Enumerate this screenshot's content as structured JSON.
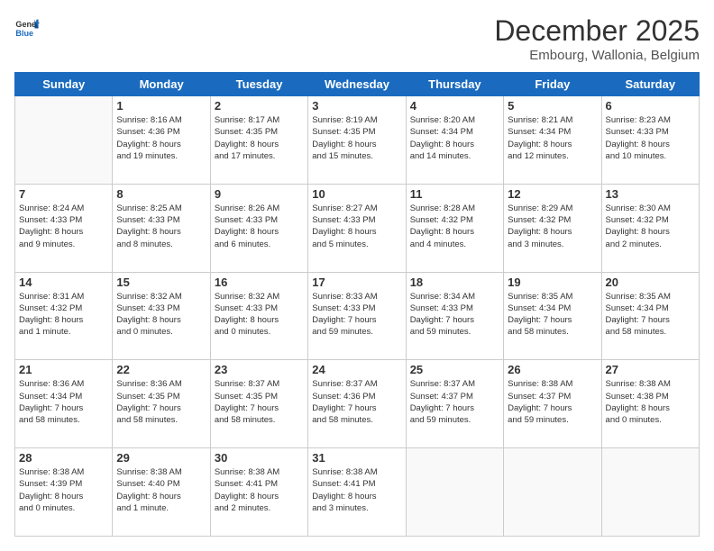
{
  "header": {
    "logo_general": "General",
    "logo_blue": "Blue",
    "month_year": "December 2025",
    "location": "Embourg, Wallonia, Belgium"
  },
  "weekdays": [
    "Sunday",
    "Monday",
    "Tuesday",
    "Wednesday",
    "Thursday",
    "Friday",
    "Saturday"
  ],
  "weeks": [
    [
      {
        "day": "",
        "info": ""
      },
      {
        "day": "1",
        "info": "Sunrise: 8:16 AM\nSunset: 4:36 PM\nDaylight: 8 hours\nand 19 minutes."
      },
      {
        "day": "2",
        "info": "Sunrise: 8:17 AM\nSunset: 4:35 PM\nDaylight: 8 hours\nand 17 minutes."
      },
      {
        "day": "3",
        "info": "Sunrise: 8:19 AM\nSunset: 4:35 PM\nDaylight: 8 hours\nand 15 minutes."
      },
      {
        "day": "4",
        "info": "Sunrise: 8:20 AM\nSunset: 4:34 PM\nDaylight: 8 hours\nand 14 minutes."
      },
      {
        "day": "5",
        "info": "Sunrise: 8:21 AM\nSunset: 4:34 PM\nDaylight: 8 hours\nand 12 minutes."
      },
      {
        "day": "6",
        "info": "Sunrise: 8:23 AM\nSunset: 4:33 PM\nDaylight: 8 hours\nand 10 minutes."
      }
    ],
    [
      {
        "day": "7",
        "info": "Sunrise: 8:24 AM\nSunset: 4:33 PM\nDaylight: 8 hours\nand 9 minutes."
      },
      {
        "day": "8",
        "info": "Sunrise: 8:25 AM\nSunset: 4:33 PM\nDaylight: 8 hours\nand 8 minutes."
      },
      {
        "day": "9",
        "info": "Sunrise: 8:26 AM\nSunset: 4:33 PM\nDaylight: 8 hours\nand 6 minutes."
      },
      {
        "day": "10",
        "info": "Sunrise: 8:27 AM\nSunset: 4:33 PM\nDaylight: 8 hours\nand 5 minutes."
      },
      {
        "day": "11",
        "info": "Sunrise: 8:28 AM\nSunset: 4:32 PM\nDaylight: 8 hours\nand 4 minutes."
      },
      {
        "day": "12",
        "info": "Sunrise: 8:29 AM\nSunset: 4:32 PM\nDaylight: 8 hours\nand 3 minutes."
      },
      {
        "day": "13",
        "info": "Sunrise: 8:30 AM\nSunset: 4:32 PM\nDaylight: 8 hours\nand 2 minutes."
      }
    ],
    [
      {
        "day": "14",
        "info": "Sunrise: 8:31 AM\nSunset: 4:32 PM\nDaylight: 8 hours\nand 1 minute."
      },
      {
        "day": "15",
        "info": "Sunrise: 8:32 AM\nSunset: 4:33 PM\nDaylight: 8 hours\nand 0 minutes."
      },
      {
        "day": "16",
        "info": "Sunrise: 8:32 AM\nSunset: 4:33 PM\nDaylight: 8 hours\nand 0 minutes."
      },
      {
        "day": "17",
        "info": "Sunrise: 8:33 AM\nSunset: 4:33 PM\nDaylight: 7 hours\nand 59 minutes."
      },
      {
        "day": "18",
        "info": "Sunrise: 8:34 AM\nSunset: 4:33 PM\nDaylight: 7 hours\nand 59 minutes."
      },
      {
        "day": "19",
        "info": "Sunrise: 8:35 AM\nSunset: 4:34 PM\nDaylight: 7 hours\nand 58 minutes."
      },
      {
        "day": "20",
        "info": "Sunrise: 8:35 AM\nSunset: 4:34 PM\nDaylight: 7 hours\nand 58 minutes."
      }
    ],
    [
      {
        "day": "21",
        "info": "Sunrise: 8:36 AM\nSunset: 4:34 PM\nDaylight: 7 hours\nand 58 minutes."
      },
      {
        "day": "22",
        "info": "Sunrise: 8:36 AM\nSunset: 4:35 PM\nDaylight: 7 hours\nand 58 minutes."
      },
      {
        "day": "23",
        "info": "Sunrise: 8:37 AM\nSunset: 4:35 PM\nDaylight: 7 hours\nand 58 minutes."
      },
      {
        "day": "24",
        "info": "Sunrise: 8:37 AM\nSunset: 4:36 PM\nDaylight: 7 hours\nand 58 minutes."
      },
      {
        "day": "25",
        "info": "Sunrise: 8:37 AM\nSunset: 4:37 PM\nDaylight: 7 hours\nand 59 minutes."
      },
      {
        "day": "26",
        "info": "Sunrise: 8:38 AM\nSunset: 4:37 PM\nDaylight: 7 hours\nand 59 minutes."
      },
      {
        "day": "27",
        "info": "Sunrise: 8:38 AM\nSunset: 4:38 PM\nDaylight: 8 hours\nand 0 minutes."
      }
    ],
    [
      {
        "day": "28",
        "info": "Sunrise: 8:38 AM\nSunset: 4:39 PM\nDaylight: 8 hours\nand 0 minutes."
      },
      {
        "day": "29",
        "info": "Sunrise: 8:38 AM\nSunset: 4:40 PM\nDaylight: 8 hours\nand 1 minute."
      },
      {
        "day": "30",
        "info": "Sunrise: 8:38 AM\nSunset: 4:41 PM\nDaylight: 8 hours\nand 2 minutes."
      },
      {
        "day": "31",
        "info": "Sunrise: 8:38 AM\nSunset: 4:41 PM\nDaylight: 8 hours\nand 3 minutes."
      },
      {
        "day": "",
        "info": ""
      },
      {
        "day": "",
        "info": ""
      },
      {
        "day": "",
        "info": ""
      }
    ]
  ]
}
